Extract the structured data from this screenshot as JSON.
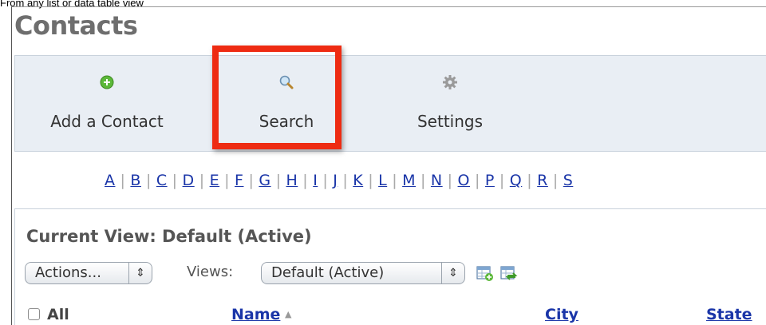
{
  "caption": "From any list or data table view",
  "page_title": "Contacts",
  "toolbar": {
    "add_contact": "Add a Contact",
    "search": "Search",
    "settings": "Settings"
  },
  "alphabet": [
    "A",
    "B",
    "C",
    "D",
    "E",
    "F",
    "G",
    "H",
    "I",
    "J",
    "K",
    "L",
    "M",
    "N",
    "O",
    "P",
    "Q",
    "R",
    "S"
  ],
  "current_view": "Current View: Default (Active)",
  "actions_select": "Actions...",
  "views_label": "Views:",
  "views_select": "Default (Active)",
  "table": {
    "select_all": "All",
    "columns": [
      "Name",
      "City",
      "State"
    ]
  },
  "colors": {
    "highlight": "#ee2b12",
    "link": "#1a35a8",
    "toolbar_bg": "#e9eef4"
  }
}
